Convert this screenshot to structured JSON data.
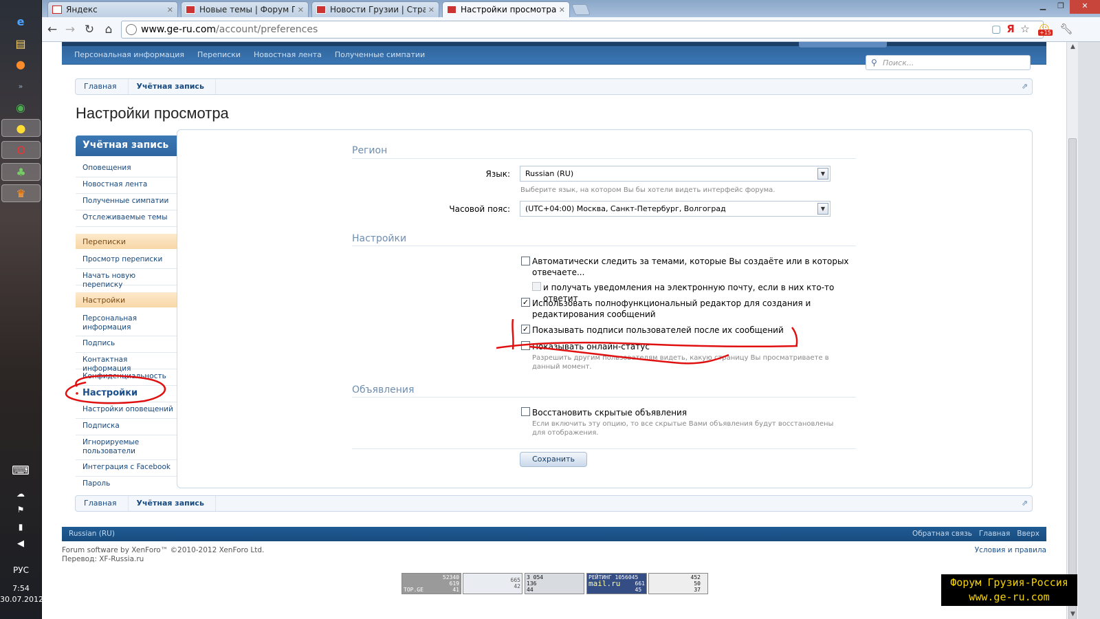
{
  "taskbar": {
    "language": "РУС",
    "time": "7:54",
    "date": "30.07.2012"
  },
  "browser": {
    "tabs": [
      {
        "label": "Яндекс"
      },
      {
        "label": "Новые темы | Форум Грузи"
      },
      {
        "label": "Новости Грузии | Страниц"
      },
      {
        "label": "Настройки просмотра | Фо"
      }
    ],
    "url_host": "www.ge-ru.com",
    "url_path": "/account/preferences",
    "badge": "+15"
  },
  "header": {
    "subnav": [
      "Персональная информация",
      "Переписки",
      "Новостная лента",
      "Полученные симпатии"
    ],
    "search_placeholder": "Поиск..."
  },
  "breadcrumb": [
    "Главная",
    "Учётная запись"
  ],
  "page_title": "Настройки просмотра",
  "sidebar": {
    "title": "Учётная запись",
    "group1": [
      "Оповещения",
      "Новостная лента",
      "Полученные симпатии",
      "Отслеживаемые темы"
    ],
    "section_conversations": "Переписки",
    "group2": [
      "Просмотр переписки",
      "Начать новую переписку"
    ],
    "section_settings": "Настройки",
    "group3": [
      "Персональная информация",
      "Подпись",
      "Контактная информация",
      "Конфиденциальность"
    ],
    "selected": "Настройки",
    "group4": [
      "Настройки оповещений",
      "Подписка",
      "Игнорируемые пользователи",
      "Интеграция с Facebook",
      "Пароль"
    ]
  },
  "form": {
    "region_title": "Регион",
    "language_label": "Язык:",
    "language_value": "Russian (RU)",
    "language_hint": "Выберите язык, на котором Вы бы хотели видеть интерфейс форума.",
    "timezone_label": "Часовой пояс:",
    "timezone_value": "(UTC+04:00) Москва, Санкт-Петербург, Волгоград",
    "settings_title": "Настройки",
    "watch_threads": "Автоматически следить за темами, которые Вы создаёте или в которых отвечаете...",
    "watch_email": "и получать уведомления на электронную почту, если в них кто-то ответит",
    "rich_editor": "Использовать полнофункциональный редактор для создания и редактирования сообщений",
    "show_signatures": "Показывать подписи пользователей после их сообщений",
    "show_online": "Показывать онлайн-статус",
    "show_online_hint": "Разрешить другим пользователям видеть, какую страницу Вы просматриваете в данный момент.",
    "notices_title": "Объявления",
    "restore_notices": "Восстановить скрытые объявления",
    "restore_notices_hint": "Если включить эту опцию, то все скрытые Вами объявления будут восстановлены для отображения.",
    "save_label": "Сохранить",
    "checkbox_states": {
      "watch_threads": false,
      "watch_email": false,
      "rich_editor": true,
      "show_signatures": true,
      "show_online": false,
      "restore_notices": false
    }
  },
  "footer": {
    "language": "Russian (RU)",
    "links": [
      "Обратная связь",
      "Главная",
      "Вверх"
    ],
    "copyright": "Forum software by XenForo™ ©2010-2012 XenForo Ltd.",
    "translation": "Перевод: XF-Russia.ru",
    "terms": "Условия и правила"
  },
  "counters": {
    "topge": [
      "52340",
      "619",
      "41",
      "TOP.GE"
    ],
    "c2": [
      "665",
      "42"
    ],
    "c3": [
      "3 054",
      "136",
      "44"
    ],
    "mailru": [
      "РЕЙТИНГ",
      "1056045",
      "661",
      "45",
      "mail.ru"
    ],
    "c5": [
      "452",
      "50",
      "37"
    ]
  },
  "watermark": [
    "Форум Грузия-Россия",
    "www.ge-ru.com"
  ],
  "colors": {
    "accent": "#3b78b4",
    "annotation": "#e01010",
    "section": "#f7d7a7"
  }
}
